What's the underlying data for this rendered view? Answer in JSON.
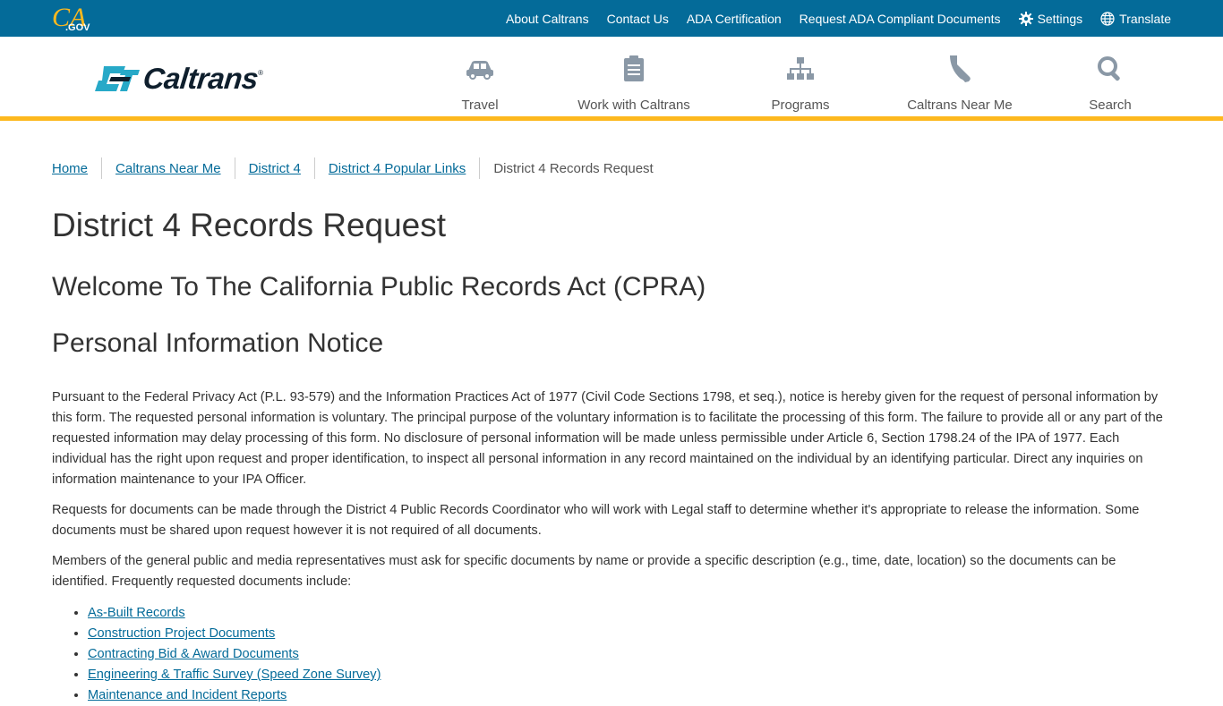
{
  "colors": {
    "utility_bar": "#046b99",
    "accent_rule": "#fdb81e",
    "link": "#046b99",
    "brand_teal": "#27a9c8"
  },
  "utility": {
    "logo_alt": "CA.GOV",
    "links": [
      "About Caltrans",
      "Contact Us",
      "ADA Certification",
      "Request ADA Compliant Documents"
    ],
    "settings_label": "Settings",
    "translate_label": "Translate"
  },
  "header": {
    "brand": "Caltrans",
    "nav": [
      {
        "label": "Travel",
        "icon": "car-icon"
      },
      {
        "label": "Work with Caltrans",
        "icon": "clipboard-icon"
      },
      {
        "label": "Programs",
        "icon": "org-chart-icon"
      },
      {
        "label": "Caltrans Near Me",
        "icon": "california-map-icon"
      },
      {
        "label": "Search",
        "icon": "search-icon"
      }
    ]
  },
  "breadcrumb": {
    "items": [
      "Home",
      "Caltrans Near Me",
      "District 4",
      "District 4 Popular Links"
    ],
    "current": "District 4 Records Request"
  },
  "main": {
    "title": "District 4 Records Request",
    "heading_welcome": "Welcome To The California Public Records Act (CPRA)",
    "heading_notice": "Personal Information Notice",
    "paragraphs": [
      "Pursuant to the Federal Privacy Act (P.L. 93-579) and the Information Practices Act of 1977 (Civil Code Sections 1798, et seq.), notice is hereby given for the request of personal information by this form. The requested personal information is voluntary. The principal purpose of the voluntary information is to facilitate the processing of this form. The failure to provide all or any part of the requested information may delay processing of this form. No disclosure of personal information will be made unless permissible under Article 6, Section 1798.24 of the IPA of 1977. Each individual has the right upon request and proper identification, to inspect all personal information in any record maintained on the individual by an identifying particular. Direct any inquiries on information maintenance to your IPA Officer.",
      "Requests for documents can be made through the District 4 Public Records Coordinator who will work with Legal staff to determine whether it's appropriate to release the information. Some documents must be shared upon request however it is not required of all documents.",
      "Members of the general public and media representatives must ask for specific documents by name or provide a specific description (e.g., time, date, location) so the documents can be identified. Frequently requested documents include:"
    ],
    "doc_links": [
      "As-Built Records",
      "Construction Project Documents",
      "Contracting Bid & Award Documents",
      "Engineering & Traffic Survey (Speed Zone Survey)",
      "Maintenance and Incident Reports"
    ]
  }
}
